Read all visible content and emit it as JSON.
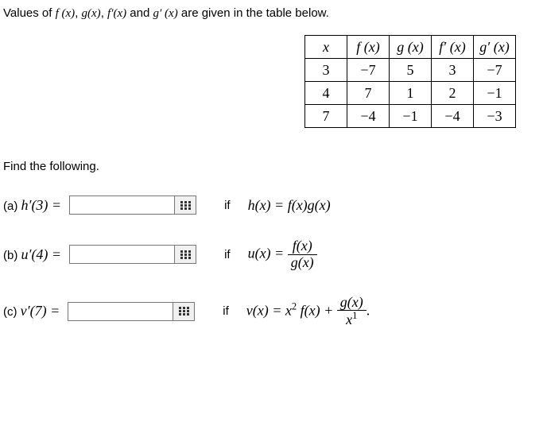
{
  "intro": {
    "prefix": "Values of ",
    "f1": "f (x)",
    "sep1": ", ",
    "f2": "g(x)",
    "sep2": ", ",
    "f3": "f′(x)",
    "and": " and ",
    "f4": "g′ (x)",
    "suffix": " are given in the table below."
  },
  "table": {
    "headers": [
      "x",
      "f (x)",
      "g (x)",
      "f′ (x)",
      "g′ (x)"
    ],
    "rows": [
      [
        "3",
        "−7",
        "5",
        "3",
        "−7"
      ],
      [
        "4",
        "7",
        "1",
        "2",
        "−1"
      ],
      [
        "7",
        "−4",
        "−1",
        "−4",
        "−3"
      ]
    ]
  },
  "find_label": "Find the following.",
  "questions": {
    "a": {
      "label": "(a) ",
      "lhs": "h′(3) =",
      "if": "if",
      "rhs": "h(x) = f(x)g(x)"
    },
    "b": {
      "label": "(b) ",
      "lhs": "u′(4) =",
      "if": "if",
      "rhs_lhs": "u(x) = ",
      "rhs_num": "f(x)",
      "rhs_den": "g(x)"
    },
    "c": {
      "label": "(c) ",
      "lhs": "v′(7) =",
      "if": "if",
      "rhs_lhs": "v(x) = x",
      "rhs_exp": "2",
      "rhs_mid": " f(x) + ",
      "rhs_num": "g(x)",
      "rhs_den_base": "x",
      "rhs_den_exp": "1",
      "rhs_end": "."
    }
  }
}
